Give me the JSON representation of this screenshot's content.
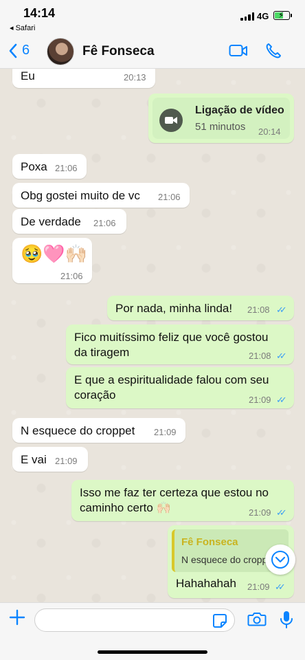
{
  "status_bar": {
    "time": "14:14",
    "back_app": "◂ Safari",
    "network": "4G"
  },
  "header": {
    "back_count": "6",
    "contact_name": "Fê Fonseca"
  },
  "messages": [
    {
      "text": "Eu",
      "time": "20:13"
    },
    {
      "call_title": "Ligação de vídeo",
      "call_duration": "51 minutos",
      "time": "20:14"
    },
    {
      "text": "Poxa",
      "time": "21:06"
    },
    {
      "text": "Obg gostei muito de vc",
      "time": "21:06"
    },
    {
      "text": "De verdade",
      "time": "21:06"
    },
    {
      "text": "🥹🩷🙌🏻",
      "time": "21:06"
    },
    {
      "text": "Por nada, minha linda!",
      "time": "21:08"
    },
    {
      "line1": "Fico muitíssimo feliz que você gostou",
      "line2": "da tiragem",
      "time": "21:08"
    },
    {
      "line1": "E que a espiritualidade falou com seu",
      "line2": "coração",
      "time": "21:09"
    },
    {
      "text": "N esquece do croppet",
      "time": "21:09"
    },
    {
      "text": "E vai",
      "time": "21:09"
    },
    {
      "line1": "Isso me faz ter certeza que estou no",
      "line2": "caminho certo 🙌🏻",
      "time": "21:09"
    },
    {
      "reply_author": "Fê Fonseca",
      "reply_text": "N esquece do croppet",
      "text": "Hahahahah",
      "time": "21:09"
    }
  ],
  "composer": {
    "placeholder": ""
  },
  "icons": {
    "back": "chevron-left-icon",
    "video": "video-camera-icon",
    "call": "phone-icon",
    "plus": "plus-icon",
    "sticker": "sticker-icon",
    "camera": "camera-icon",
    "mic": "microphone-icon",
    "scroll": "chevron-down-icon"
  },
  "colors": {
    "accent": "#0a84ff",
    "outgoing": "#dcf8c6",
    "incoming": "#ffffff",
    "read_ticks": "#3b9ef5",
    "reply_bar": "#d9c82a",
    "reply_author": "#c9b420"
  }
}
